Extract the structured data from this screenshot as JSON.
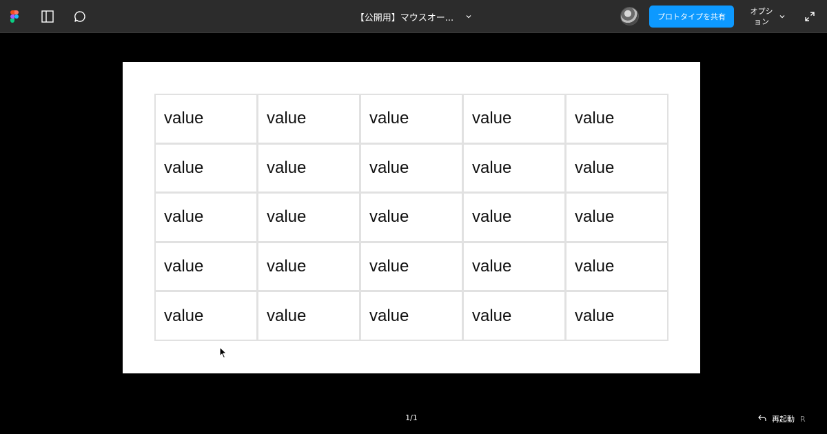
{
  "toolbar": {
    "title": "【公開用】マウスオー...",
    "share_label": "プロトタイプを共有",
    "options_label": "オプション",
    "icons": [
      "figma-logo-icon",
      "sidebar-icon",
      "comment-icon",
      "chevron-down-icon",
      "expand-icon"
    ]
  },
  "colors": {
    "toolbar_bg": "#2c2c2c",
    "canvas_bg": "#000000",
    "accent": "#0d99ff",
    "grid_border": "#e1e1e1"
  },
  "table": {
    "rows": [
      [
        "value",
        "value",
        "value",
        "value",
        "value"
      ],
      [
        "value",
        "value",
        "value",
        "value",
        "value"
      ],
      [
        "value",
        "value",
        "value",
        "value",
        "value"
      ],
      [
        "value",
        "value",
        "value",
        "value",
        "value"
      ],
      [
        "value",
        "value",
        "value",
        "value",
        "value"
      ]
    ]
  },
  "footer": {
    "page_counter": "1/1",
    "restart_label": "再起動",
    "restart_shortcut": "R"
  }
}
